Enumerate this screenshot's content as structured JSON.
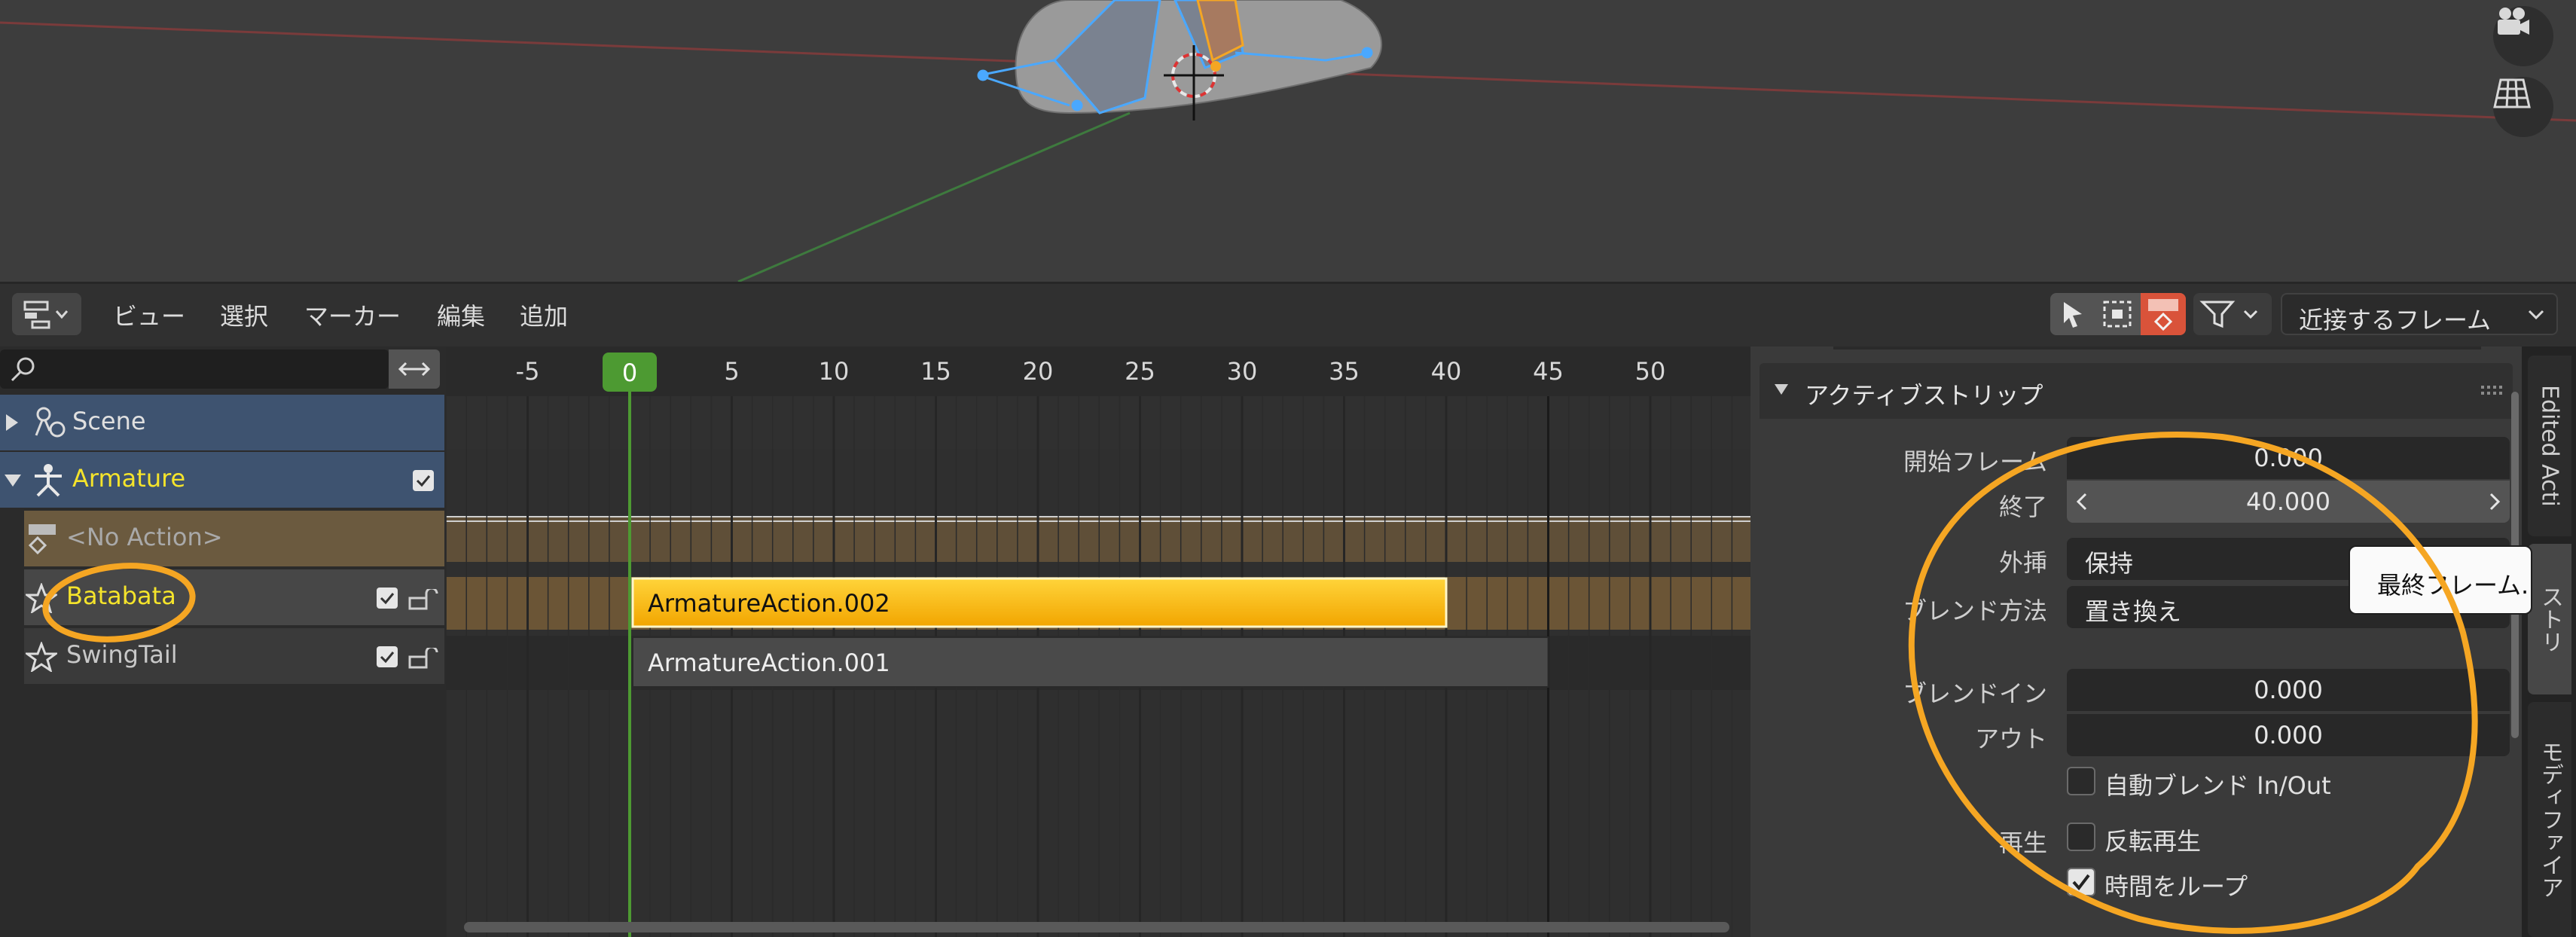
{
  "header": {
    "menus": [
      "ビュー",
      "選択",
      "マーカー",
      "編集",
      "追加"
    ],
    "snap_mode": "近接するフレーム"
  },
  "channels": {
    "search_placeholder": "",
    "scene": "Scene",
    "armature": "Armature",
    "no_action": "<No Action>",
    "tracks": [
      "Batabata",
      "SwingTail"
    ]
  },
  "timeline": {
    "frame_ticks": [
      -5,
      0,
      5,
      10,
      15,
      20,
      25,
      30,
      35,
      40,
      45,
      50
    ],
    "current_frame": "0",
    "strips": [
      {
        "name": "ArmatureAction.002",
        "start": 0,
        "end": 40,
        "selected": true
      },
      {
        "name": "ArmatureAction.001",
        "start": 0,
        "end": 45,
        "selected": false
      }
    ]
  },
  "sidebar": {
    "panel_title": "アクティブストリップ",
    "start_label": "開始フレーム",
    "start_value": "0.000",
    "end_label": "終了",
    "end_value": "40.000",
    "extrapolation_label": "外挿",
    "extrapolation_value": "保持",
    "blend_label": "ブレンド方法",
    "blend_value": "置き換え",
    "blend_in_label": "ブレンドイン",
    "blend_in_value": "0.000",
    "blend_out_label": "アウト",
    "blend_out_value": "0.000",
    "auto_blend_label": "自動ブレンド In/Out",
    "playback_label": "再生",
    "reverse_label": "反転再生",
    "loop_label": "時間をループ",
    "tooltip": "最終フレーム."
  },
  "tabs": [
    "Edited Acti",
    "ストリ",
    "モディファイア"
  ],
  "colors": {
    "accent_orange": "#f5a623",
    "strip_selected": "#f7b800",
    "playhead_green": "#4d9a32"
  }
}
